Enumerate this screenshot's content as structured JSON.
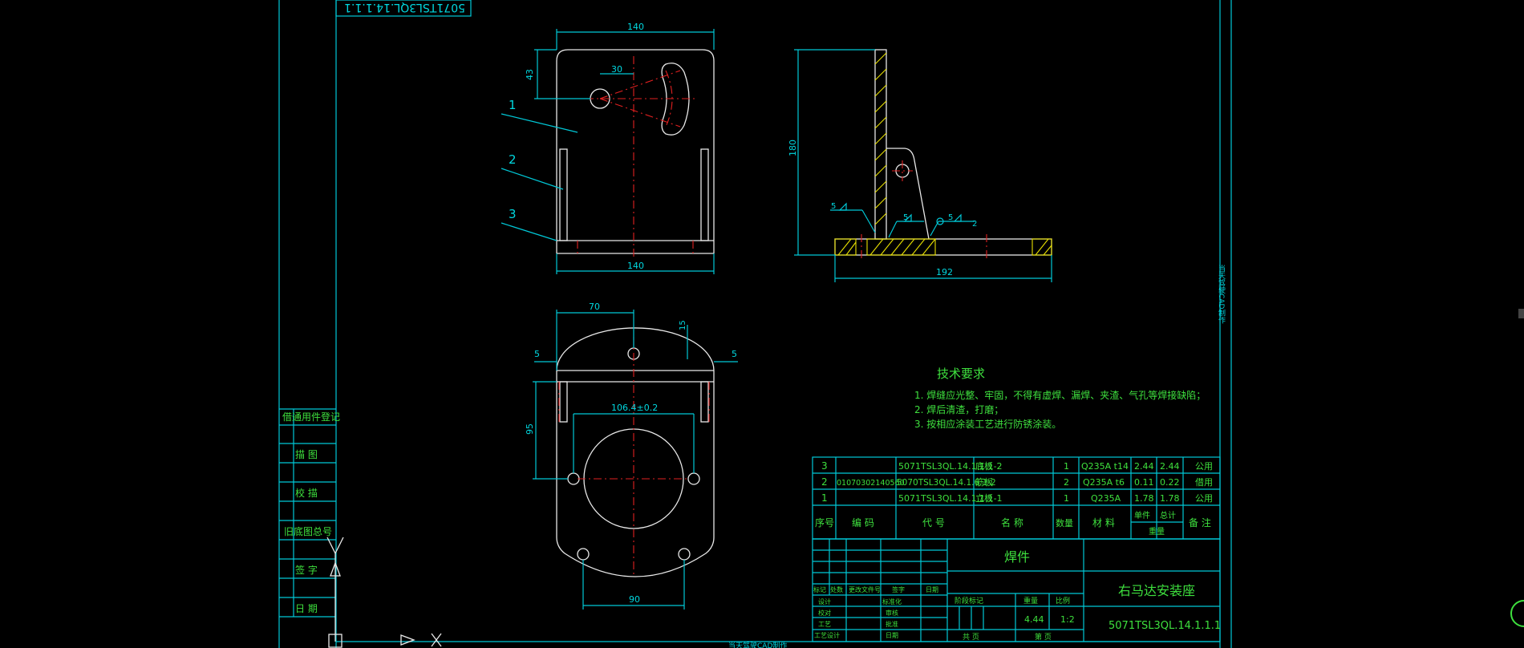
{
  "drawing": {
    "top_label": "5071TSL3QL.14.1.1.1",
    "side_label": "当天驾驶CAD制作",
    "bottom_label": "当天驾驶CAD制作"
  },
  "left_panel": {
    "items": [
      "借通用件登记",
      "描 图",
      "校 描",
      "旧底图总号",
      "签 字",
      "日 期"
    ]
  },
  "front_view": {
    "dim_top": "140",
    "dim_43": "43",
    "dim_30": "30",
    "dim_bottom": "140",
    "leaders": [
      "1",
      "2",
      "3"
    ]
  },
  "side_view": {
    "dim_height": "180",
    "dim_width": "192",
    "weld_labels": [
      "5",
      "5",
      "5",
      "2"
    ]
  },
  "bottom_view": {
    "dim_70": "70",
    "dim_15": "15",
    "dim_5_left": "5",
    "dim_5_right": "5",
    "dim_95": "95",
    "dim_106": "106.4±0.2",
    "dim_90": "90"
  },
  "tech_requirements": {
    "title": "技术要求",
    "lines": [
      "1. 焊缝应光整、牢固，不得有虚焊、漏焊、夹渣、气孔等焊接缺陷；",
      "2. 焊后清渣，打磨；",
      "3. 按相应涂装工艺进行防锈涂装。"
    ]
  },
  "bom": {
    "rows": [
      {
        "no": "3",
        "code": "",
        "part": "5071TSL3QL.14.1.1.1-2",
        "name": "底板",
        "qty": "1",
        "material": "Q235A t14",
        "unit_w": "2.44",
        "total_w": "2.44",
        "note": "公用"
      },
      {
        "no": "2",
        "code": "01070302140560",
        "part": "5070TSL3QL.14.1.6.1-2",
        "name": "筋板",
        "qty": "2",
        "material": "Q235A t6",
        "unit_w": "0.11",
        "total_w": "0.22",
        "note": "借用"
      },
      {
        "no": "1",
        "code": "",
        "part": "5071TSL3QL.14.1.1.1-1",
        "name": "立板",
        "qty": "1",
        "material": "Q235A",
        "unit_w": "1.78",
        "total_w": "1.78",
        "note": "公用"
      }
    ],
    "headers": {
      "no": "序号",
      "code": "编 码",
      "part": "代 号",
      "name": "名 称",
      "qty": "数量",
      "material": "材 料",
      "unit_w": "单件",
      "total_w": "总计",
      "weight": "重量",
      "note": "备 注"
    }
  },
  "title_block": {
    "type": "焊件",
    "name": "右马达安装座",
    "drawing_no": "5071TSL3QL.14.1.1.1",
    "weight": "4.44",
    "scale": "1:2",
    "labels": {
      "mark": "标记",
      "count": "处数",
      "change_doc": "更改文件号",
      "signature": "签字",
      "date": "日期",
      "design": "设计",
      "std": "标准化",
      "check": "校对",
      "review": "审核",
      "process": "工艺",
      "approve": "批准",
      "process_designer": "工艺设计",
      "stage_mark": "阶段标记",
      "weight_label": "重量",
      "scale_label": "比例",
      "total_sheets": "共 页",
      "sheet": "第 页"
    }
  },
  "colors": {
    "background": "#000000",
    "frame": "#00c8d7",
    "outline": "#e8e8e8",
    "center": "#e02020",
    "hatch": "#e8e000",
    "text": "#3ee03e"
  }
}
